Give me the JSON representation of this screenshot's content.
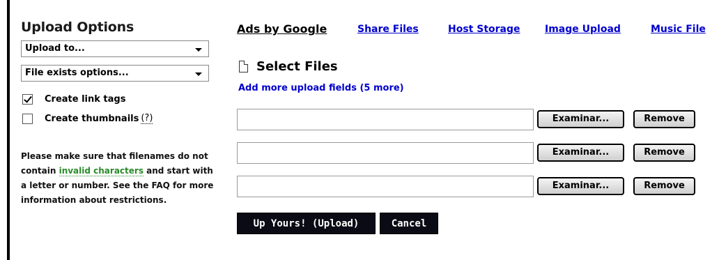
{
  "upload_options": {
    "title": "Upload Options",
    "upload_to": "Upload to...",
    "file_exists": "File exists options...",
    "create_link_tags": {
      "label": "Create link tags",
      "checked": true
    },
    "create_thumbnails": {
      "label": "Create thumbnails",
      "help": "(?)",
      "checked": false
    },
    "notice": {
      "part1": "Please make sure that filenames do not contain ",
      "link": "invalid characters",
      "part2": " and start with a letter or number. See the FAQ for more information about restrictions."
    }
  },
  "ads": {
    "title": "Ads by Google",
    "links": [
      "Share Files",
      "Host Storage",
      "Image Upload",
      "Music File"
    ]
  },
  "select_files": {
    "title": "Select Files",
    "add_more": "Add more upload fields  (5 more)"
  },
  "file_rows": [
    {
      "value": "",
      "browse_label": "Examinar...",
      "remove_label": "Remove"
    },
    {
      "value": "",
      "browse_label": "Examinar...",
      "remove_label": "Remove"
    },
    {
      "value": "",
      "browse_label": "Examinar...",
      "remove_label": "Remove"
    }
  ],
  "actions": {
    "upload_label": "Up Yours! (Upload)",
    "cancel_label": "Cancel"
  }
}
